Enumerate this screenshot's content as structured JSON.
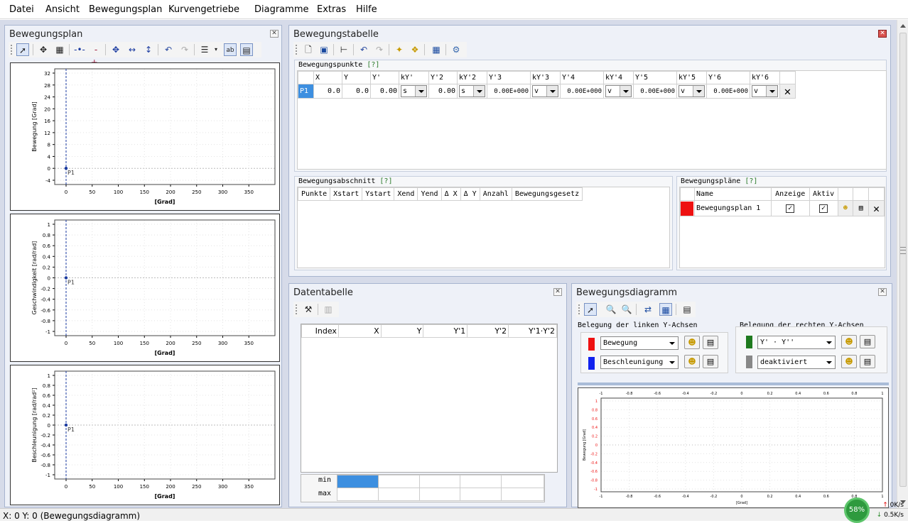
{
  "menu": [
    "Datei",
    "Ansicht",
    "Bewegungsplan",
    "Kurvengetriebe",
    "Diagramme",
    "Extras",
    "Hilfe"
  ],
  "left_panel": {
    "title": "Bewegungsplan"
  },
  "left_charts": [
    {
      "ylabel": "Bewegung [Grad]",
      "xlabel": "[Grad]",
      "yticks": [
        "32",
        "28",
        "24",
        "20",
        "16",
        "12",
        "8",
        "4",
        "0",
        "-4"
      ],
      "point": "P1"
    },
    {
      "ylabel": "Geschwindigkeit [rad/rad]",
      "xlabel": "[Grad]",
      "yticks": [
        "1",
        "0.8",
        "0.6",
        "0.4",
        "0.2",
        "0",
        "-0.2",
        "-0.4",
        "-0.6",
        "-0.8",
        "-1"
      ],
      "point": "P1"
    },
    {
      "ylabel": "Beschleunigung [rad/rad²]",
      "xlabel": "[Grad]",
      "yticks": [
        "1",
        "0.8",
        "0.6",
        "0.4",
        "0.2",
        "0",
        "-0.2",
        "-0.4",
        "-0.6",
        "-0.8",
        "-1"
      ],
      "point": "P1"
    }
  ],
  "left_xticks": [
    "0",
    "50",
    "100",
    "150",
    "200",
    "250",
    "300",
    "350"
  ],
  "tabelle": {
    "title": "Bewegungstabelle",
    "punkte_title": "Bewegungspunkte",
    "help": "[?]",
    "headers": [
      "X",
      "Y",
      "Y'",
      "kY'",
      "Y'2",
      "kY'2",
      "Y'3",
      "kY'3",
      "Y'4",
      "kY'4",
      "Y'5",
      "kY'5",
      "Y'6",
      "kY'6"
    ],
    "row": {
      "label": "P1",
      "x": "0.0",
      "y": "0.0",
      "y1": "0.00",
      "ky1": "s",
      "y2": "0.00",
      "ky2": "s",
      "y3": "0.00E+000",
      "ky3": "v",
      "y4": "0.00E+000",
      "ky4": "v",
      "y5": "0.00E+000",
      "ky5": "v",
      "y6": "0.00E+000",
      "ky6": "v"
    },
    "abschnitt_title": "Bewegungsabschnitt",
    "abschnitt_headers": [
      "Punkte",
      "Xstart",
      "Ystart",
      "Xend",
      "Yend",
      "Δ X",
      "Δ Y",
      "Anzahl",
      "Bewegungsgesetz"
    ],
    "plaene_title": "Bewegungspläne",
    "plaene_headers": [
      "Name",
      "Anzeige",
      "Aktiv"
    ],
    "plaene_row": {
      "name": "Bewegungsplan 1",
      "color": "#ee1111"
    }
  },
  "datentabelle": {
    "title": "Datentabelle",
    "headers": [
      "Index",
      "X",
      "Y",
      "Y'1",
      "Y'2",
      "Y'1·Y'2"
    ],
    "min": "min",
    "max": "max"
  },
  "diagramm": {
    "title": "Bewegungsdiagramm",
    "left_axes_title": "Belegung der linken Y-Achsen",
    "right_axes_title": "Belegung der rechten Y-Achsen",
    "left1": {
      "value": "Bewegung",
      "color": "#ee1111"
    },
    "left2": {
      "value": "Beschleunigung",
      "color": "#1122ee"
    },
    "right1": {
      "value": "Y' · Y''",
      "color": "#1f7a1f"
    },
    "right2": {
      "value": "deaktiviert",
      "color": "#888888"
    },
    "chart": {
      "ylabel": "Bewegung [Grad]",
      "xlabel": "[Grad]",
      "xticks": [
        "-1",
        "-0.8",
        "-0.6",
        "-0.4",
        "-0.2",
        "0",
        "0.2",
        "0.4",
        "0.6",
        "0.8",
        "1"
      ],
      "yticks": [
        "1",
        "0.8",
        "0.6",
        "0.4",
        "0.2",
        "0",
        "-0.2",
        "-0.4",
        "-0.6",
        "-0.8",
        "-1"
      ]
    }
  },
  "status": {
    "text": "X: 0  Y: 0 (Bewegungsdiagramm)",
    "cpu": "58%",
    "up": "0K/s",
    "down": "0.5K/s"
  }
}
